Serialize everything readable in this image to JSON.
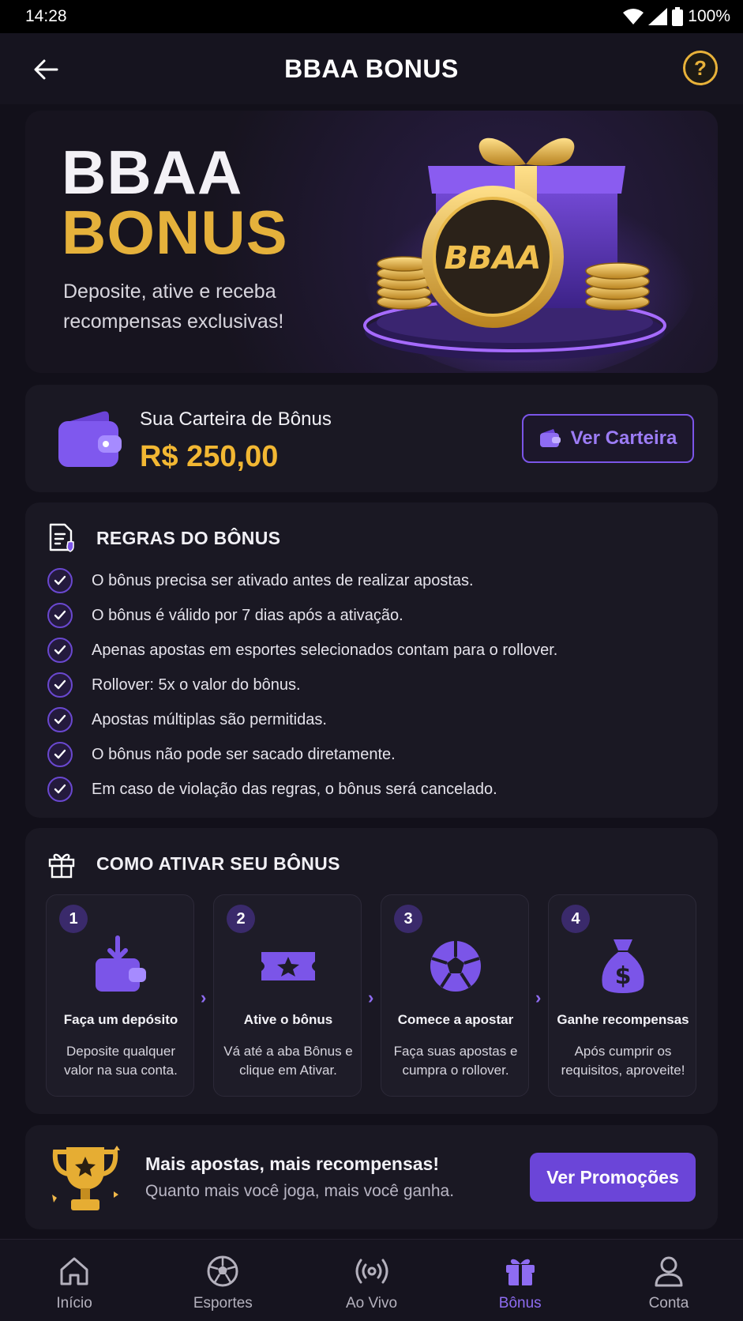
{
  "status_bar": {
    "time": "14:28",
    "battery": "100%"
  },
  "header": {
    "title": "BBAA BONUS",
    "help_symbol": "?"
  },
  "hero": {
    "title_line1": "BBAA",
    "title_line2": "BONUS",
    "subtitle": "Deposite, ative e receba recompensas exclusivas!",
    "coin_text": "BBAA"
  },
  "wallet": {
    "label": "Sua Carteira de Bônus",
    "amount": "R$ 250,00",
    "button_label": "Ver Carteira"
  },
  "rules": {
    "title": "REGRAS DO BÔNUS",
    "items": [
      "O bônus precisa ser ativado antes de realizar apostas.",
      "O bônus é válido por 7 dias após a ativação.",
      "Apenas apostas em esportes selecionados contam para o rollover.",
      "Rollover: 5x o valor do bônus.",
      "Apostas múltiplas são permitidas.",
      "O bônus não pode ser sacado diretamente.",
      "Em caso de violação das regras, o bônus será cancelado."
    ]
  },
  "activate": {
    "title": "COMO ATIVAR SEU BÔNUS",
    "steps": [
      {
        "num": "1",
        "title": "Faça um depósito",
        "desc": "Deposite qualquer valor na sua conta.",
        "icon": "wallet-deposit-icon"
      },
      {
        "num": "2",
        "title": "Ative o bônus",
        "desc": "Vá até a aba Bônus e clique em Ativar.",
        "icon": "ticket-star-icon"
      },
      {
        "num": "3",
        "title": "Comece a apostar",
        "desc": "Faça suas apostas e cumpra o rollover.",
        "icon": "soccer-ball-icon"
      },
      {
        "num": "4",
        "title": "Ganhe recompensas",
        "desc": "Após cumprir os requisitos, aproveite!",
        "icon": "money-bag-icon"
      }
    ]
  },
  "promo": {
    "title": "Mais apostas, mais recompensas!",
    "subtitle": "Quanto mais você joga, mais você ganha.",
    "button_label": "Ver Promoções"
  },
  "bottom_nav": {
    "items": [
      {
        "label": "Início",
        "icon": "home-icon"
      },
      {
        "label": "Esportes",
        "icon": "soccer-ball-icon"
      },
      {
        "label": "Ao Vivo",
        "icon": "live-broadcast-icon"
      },
      {
        "label": "Bônus",
        "icon": "gift-icon"
      },
      {
        "label": "Conta",
        "icon": "user-icon"
      }
    ],
    "active": "Bônus"
  },
  "colors": {
    "accent_purple": "#6b45d8",
    "gold": "#f2b733",
    "background": "#12101a",
    "card": "#1a1823"
  }
}
